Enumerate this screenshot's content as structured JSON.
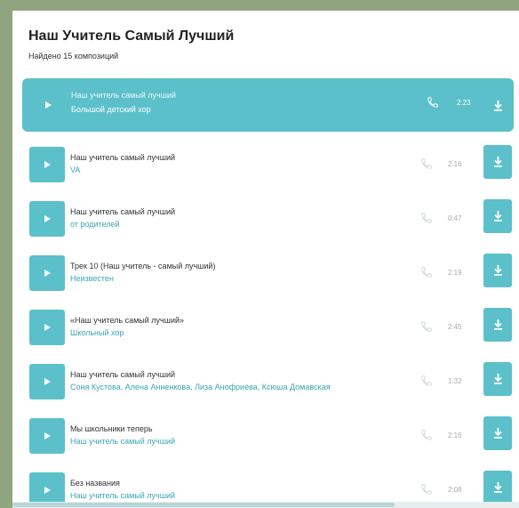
{
  "header": {
    "title": "Наш Учитель Самый Лучший",
    "found": "Найдено 15 композиций"
  },
  "colors": {
    "accent": "#5bc0ca",
    "link": "#3aa6b3",
    "bg": "#8fa57f"
  },
  "tracks": [
    {
      "title": "Наш учитель самый лучший",
      "artist": "Большой детский хор",
      "duration": "2:23",
      "active": true
    },
    {
      "title": "Наш учитель самый лучший",
      "artist": "VA",
      "duration": "2:16",
      "active": false
    },
    {
      "title": "Наш учитель самый лучший",
      "artist": "от родителей",
      "duration": "0:47",
      "active": false
    },
    {
      "title": "Трек 10 (Наш учитель - самый лучший)",
      "artist": "Неизвестен",
      "duration": "2:19",
      "active": false
    },
    {
      "title": "«Наш учитель самый лучший»",
      "artist": "Школьный хор",
      "duration": "2:45",
      "active": false
    },
    {
      "title": "Наш учитель самый лучший",
      "artist": "Соня Кустова, Алена Анненкова, Лиза Анофриева, Ксюша Домавская",
      "duration": "1:32",
      "active": false
    },
    {
      "title": "Мы школьники теперь",
      "artist": "Наш учитель самый лучший",
      "duration": "2:16",
      "active": false
    },
    {
      "title": "Без названия",
      "artist": "Наш учитель самый лучший",
      "duration": "2:08",
      "active": false
    }
  ],
  "icons": {
    "play": "play-icon",
    "phone": "phone-icon",
    "download": "download-icon"
  }
}
